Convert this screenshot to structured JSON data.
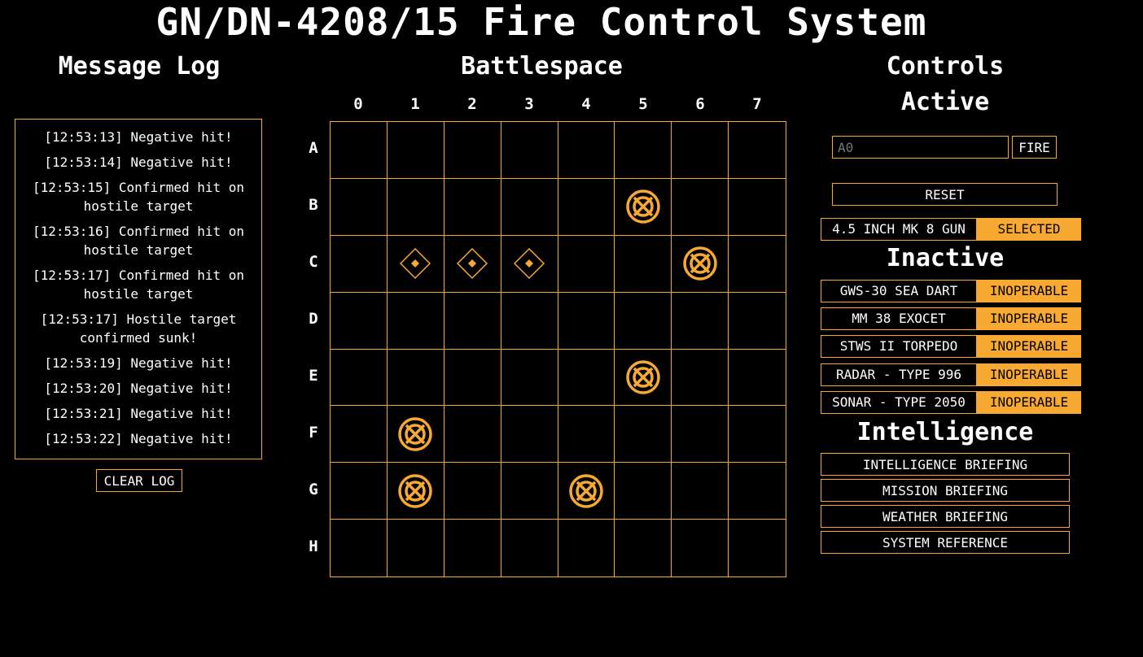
{
  "title": "GN/DN-4208/15 Fire Control System",
  "message_log": {
    "heading": "Message Log",
    "entries": [
      "[12:53:13] Negative hit!",
      "[12:53:14] Negative hit!",
      "[12:53:15] Confirmed hit on hostile target",
      "[12:53:16] Confirmed hit on hostile target",
      "[12:53:17] Confirmed hit on hostile target",
      "[12:53:17] Hostile target confirmed sunk!",
      "[12:53:19] Negative hit!",
      "[12:53:20] Negative hit!",
      "[12:53:21] Negative hit!",
      "[12:53:22] Negative hit!"
    ],
    "clear_label": "CLEAR LOG"
  },
  "battlespace": {
    "heading": "Battlespace",
    "columns": [
      "0",
      "1",
      "2",
      "3",
      "4",
      "5",
      "6",
      "7"
    ],
    "rows": [
      "A",
      "B",
      "C",
      "D",
      "E",
      "F",
      "G",
      "H"
    ],
    "markers": {
      "B5": "miss",
      "C1": "hit",
      "C2": "hit",
      "C3": "hit",
      "C6": "miss",
      "E5": "miss",
      "F1": "miss",
      "G1": "miss",
      "G4": "miss"
    },
    "marker_color": "#f7a932"
  },
  "controls": {
    "heading": "Controls",
    "active_heading": "Active",
    "target_placeholder": "A0",
    "fire_label": "FIRE",
    "reset_label": "RESET",
    "active_weapons": [
      {
        "name": "4.5 INCH MK 8 GUN",
        "status": "SELECTED"
      }
    ],
    "inactive_heading": "Inactive",
    "inactive_weapons": [
      {
        "name": "GWS-30 SEA DART",
        "status": "INOPERABLE"
      },
      {
        "name": "MM 38 EXOCET",
        "status": "INOPERABLE"
      },
      {
        "name": "STWS II TORPEDO",
        "status": "INOPERABLE"
      },
      {
        "name": "RADAR - TYPE 996",
        "status": "INOPERABLE"
      },
      {
        "name": "SONAR - TYPE 2050",
        "status": "INOPERABLE"
      }
    ],
    "intelligence_heading": "Intelligence",
    "intelligence_buttons": [
      "INTELLIGENCE BRIEFING",
      "MISSION BRIEFING",
      "WEATHER BRIEFING",
      "SYSTEM REFERENCE"
    ]
  },
  "accent_color": "#f7a932"
}
